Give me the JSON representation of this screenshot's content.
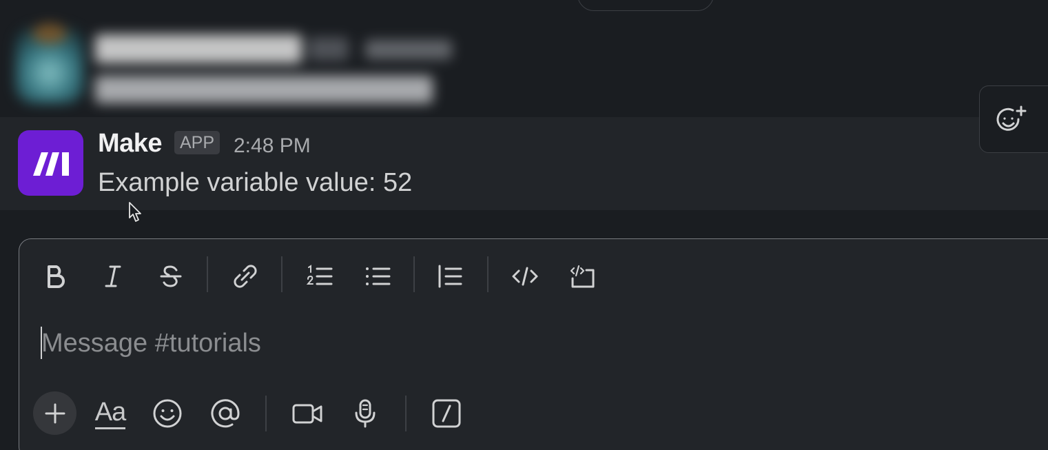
{
  "message": {
    "sender": "Make",
    "badge": "APP",
    "time": "2:48 PM",
    "text": "Example variable value: 52",
    "avatar_color": "#6d1ed4"
  },
  "reaction_toolbar": {
    "add_reaction_icon": "emoji-add-icon"
  },
  "composer": {
    "placeholder": "Message #tutorials",
    "value": "",
    "formatting_toolbar": [
      {
        "name": "bold",
        "icon": "bold-icon"
      },
      {
        "name": "italic",
        "icon": "italic-icon"
      },
      {
        "name": "strikethrough",
        "icon": "strikethrough-icon"
      },
      {
        "name": "link",
        "icon": "link-icon"
      },
      {
        "name": "ordered-list",
        "icon": "ordered-list-icon"
      },
      {
        "name": "bulleted-list",
        "icon": "bulleted-list-icon"
      },
      {
        "name": "blockquote",
        "icon": "blockquote-icon"
      },
      {
        "name": "code",
        "icon": "code-icon"
      },
      {
        "name": "code-block",
        "icon": "code-block-icon"
      }
    ],
    "bottom_toolbar": {
      "attach_icon": "plus-icon",
      "format_toggle_label": "Aa",
      "emoji_icon": "emoji-icon",
      "mention_icon": "at-icon",
      "video_icon": "video-camera-icon",
      "audio_icon": "microphone-icon",
      "shortcuts_icon": "slash-icon"
    }
  },
  "colors": {
    "background": "#1a1d21",
    "hover_row": "#222529",
    "text_primary": "#f1f1f2",
    "text_secondary": "#a9abae",
    "border": "#797c81"
  }
}
